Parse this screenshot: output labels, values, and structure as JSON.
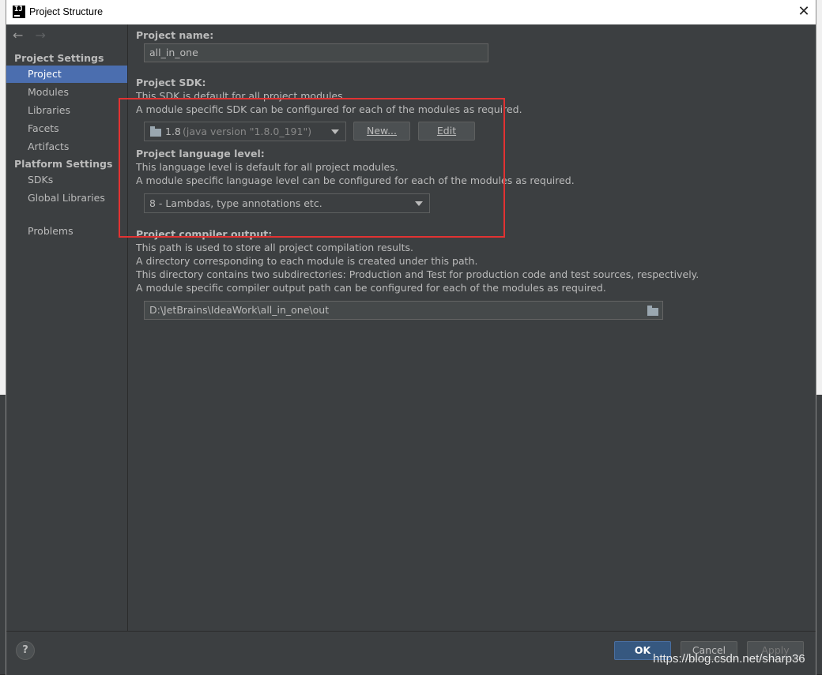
{
  "window": {
    "title": "Project Structure",
    "app_icon": "IJ",
    "close": "✕"
  },
  "nav": {
    "back": "←",
    "forward": "→"
  },
  "sidebar": {
    "project_settings_header": "Project Settings",
    "project_settings_items": [
      "Project",
      "Modules",
      "Libraries",
      "Facets",
      "Artifacts"
    ],
    "platform_settings_header": "Platform Settings",
    "platform_settings_items": [
      "SDKs",
      "Global Libraries"
    ],
    "problems": "Problems",
    "selected": "Project"
  },
  "project_name": {
    "label": "Project name:",
    "value": "all_in_one"
  },
  "sdk": {
    "label": "Project SDK:",
    "desc1": "This SDK is default for all project modules.",
    "desc2": "A module specific SDK can be configured for each of the modules as required.",
    "selected_version": "1.8",
    "selected_detail": "(java version \"1.8.0_191\")",
    "new_button": "New...",
    "edit_button": "Edit"
  },
  "language_level": {
    "label": "Project language level:",
    "desc1": "This language level is default for all project modules.",
    "desc2": "A module specific language level can be configured for each of the modules as required.",
    "selected": "8 - Lambdas, type annotations etc."
  },
  "compiler_output": {
    "label": "Project compiler output:",
    "desc1": "This path is used to store all project compilation results.",
    "desc2": "A directory corresponding to each module is created under this path.",
    "desc3": "This directory contains two subdirectories: Production and Test for production code and test sources, respectively.",
    "desc4": "A module specific compiler output path can be configured for each of the modules as required.",
    "path": "D:\\JetBrains\\IdeaWork\\all_in_one\\out"
  },
  "footer": {
    "help": "?",
    "ok": "OK",
    "cancel": "Cancel",
    "apply": "Apply"
  },
  "watermark": "https://blog.csdn.net/sharp36",
  "colors": {
    "selection": "#4b6eaf",
    "highlight_box": "#e23232",
    "panel": "#3c3f41"
  }
}
